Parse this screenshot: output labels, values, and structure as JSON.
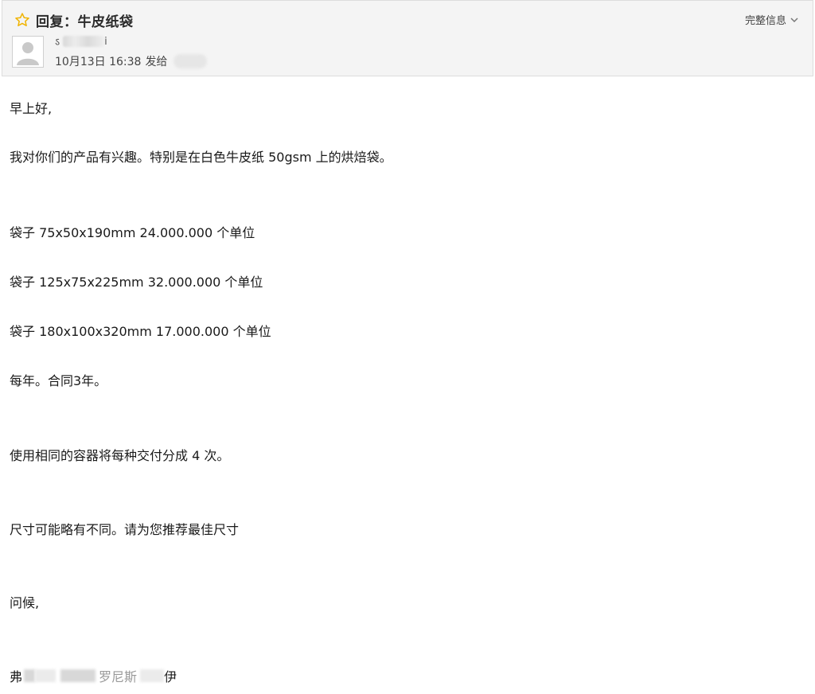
{
  "header": {
    "subject": "回复：牛皮纸袋",
    "full_info_label": "完整信息",
    "sender_name_partial": "ऽ",
    "sender_name_tail": "i",
    "sent_time": "10月13日 16:38",
    "sent_to_label": "发给"
  },
  "body": {
    "lines": [
      "早上好,",
      "我对你们的产品有兴趣。特别是在白色牛皮纸 50gsm 上的烘焙袋。",
      "袋子 75x50x190mm 24.000.000 个单位",
      "袋子 125x75x225mm 32.000.000 个单位",
      "袋子 180x100x320mm 17.000.000 个单位",
      "每年。合同3年。",
      "使用相同的容器将每种交付分成 4 次。",
      "尺寸可能略有不同。请为您推荐最佳尺寸",
      "问候,"
    ],
    "signature_start": "弗",
    "signature_mid": "罗尼斯",
    "signature_end": "伊"
  },
  "colors": {
    "header_bg": "#f4f4f4",
    "star_color": "#f0b400",
    "text": "#1a1a1a"
  },
  "icons": {
    "star": "star-outline-icon",
    "chevron": "chevron-down-icon",
    "avatar": "default-avatar-icon"
  }
}
